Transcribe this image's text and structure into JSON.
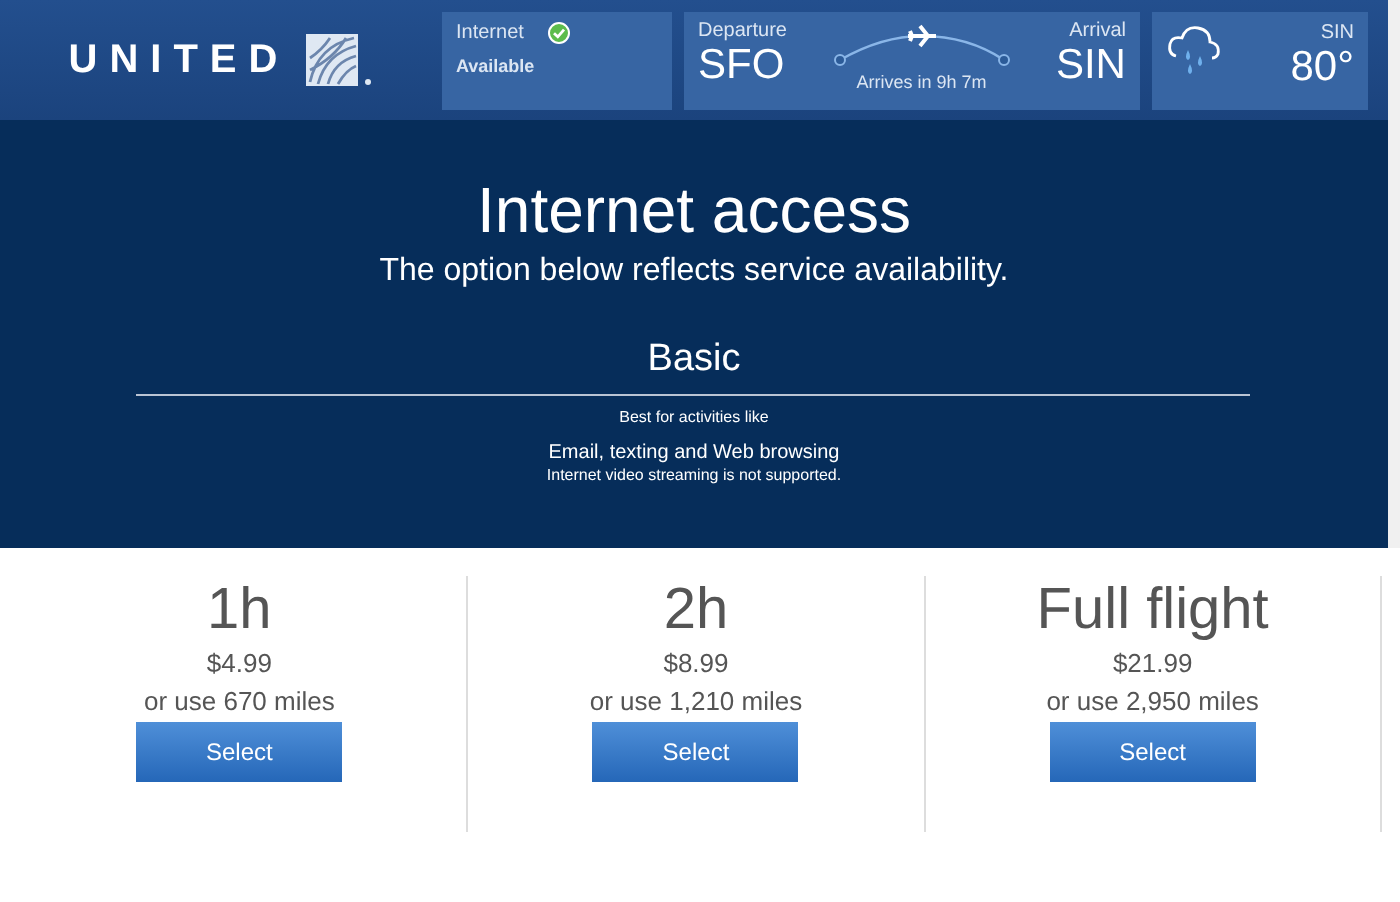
{
  "header": {
    "logo": "UNITED",
    "internet": {
      "label": "Internet",
      "status": "Available"
    },
    "flight": {
      "departure_label": "Departure",
      "departure": "SFO",
      "arrival_label": "Arrival",
      "arrival": "SIN",
      "duration": "Arrives in 9h 7m"
    },
    "weather": {
      "city": "SIN",
      "temperature": "80°"
    }
  },
  "intro": {
    "title": "Internet access",
    "subtitle": "The option below reflects service availability."
  },
  "plan": {
    "name": "Basic",
    "note": "Best for activities like",
    "activities": "Email, texting and Web browsing",
    "restriction": "Internet video streaming is not supported."
  },
  "options": [
    {
      "duration": "1h",
      "price": "$4.99",
      "miles": "or use 670 miles",
      "button": "Select"
    },
    {
      "duration": "2h",
      "price": "$8.99",
      "miles": "or use 1,210 miles",
      "button": "Select"
    },
    {
      "duration": "Full flight",
      "price": "$21.99",
      "miles": "or use 2,950 miles",
      "button": "Select"
    }
  ]
}
